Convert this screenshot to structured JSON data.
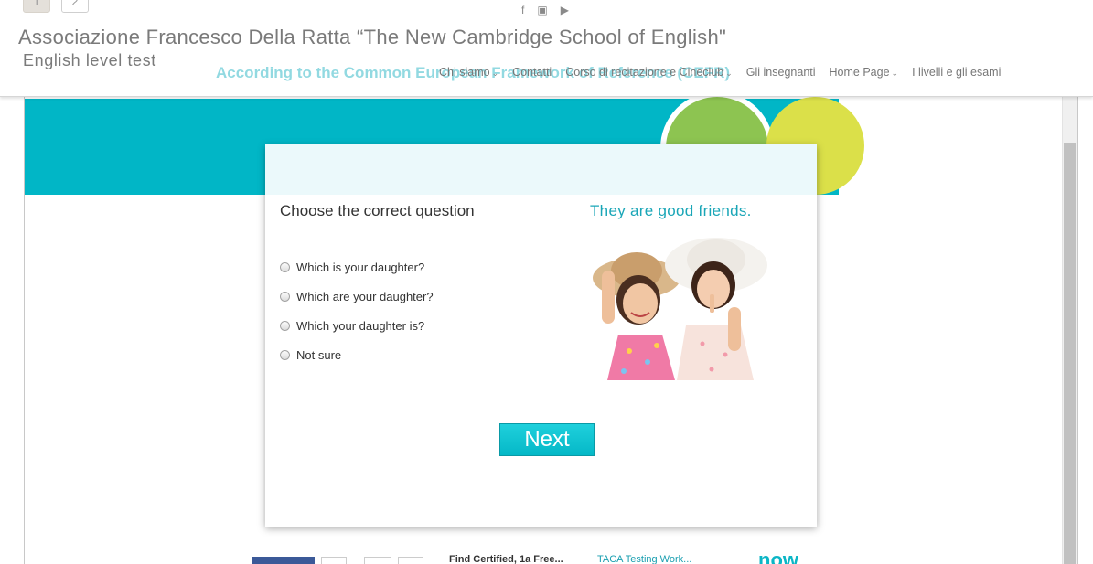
{
  "header": {
    "pager": [
      "1",
      "2"
    ],
    "title": "Associazione Francesco Della Ratta “The New Cambridge School of English\"",
    "subtitle": "English level test",
    "ghost_text": "According to the Common European Framework of Reference (CEFR)",
    "social": [
      {
        "icon": "facebook-icon",
        "glyph": "f"
      },
      {
        "icon": "instagram-icon",
        "glyph": "▣"
      },
      {
        "icon": "youtube-icon",
        "glyph": "▶"
      }
    ],
    "nav": [
      {
        "label": "Chi siamo",
        "has_dropdown": true
      },
      {
        "label": "Contatti",
        "has_dropdown": false
      },
      {
        "label": "Corso di recitazione e Cineclub",
        "has_dropdown": true
      },
      {
        "label": "Gli insegnanti",
        "has_dropdown": false
      },
      {
        "label": "Home Page",
        "has_dropdown": true
      },
      {
        "label": "I livelli e gli esami",
        "has_dropdown": false
      }
    ]
  },
  "quiz": {
    "question": "Choose the correct question",
    "sentence": "They are good friends.",
    "options": [
      "Which is your daughter?",
      "Which are your daughter?",
      "Which your daughter is?",
      "Not sure"
    ],
    "next_label": "Next"
  },
  "footer": {
    "text": "Find Certified, 1a Free...",
    "link": "TACA Testing Work...",
    "brand": "now"
  },
  "colors": {
    "teal": "#01b6c6",
    "green": "#8dc451",
    "yellow": "#dbe049",
    "accent_text": "#1aa6b7"
  }
}
